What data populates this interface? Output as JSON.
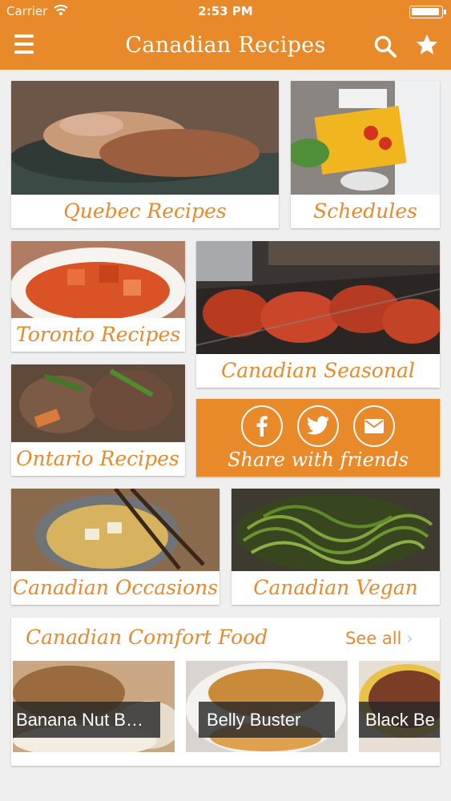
{
  "status_bar": {
    "carrier": "Carrier",
    "time": "2:53 PM"
  },
  "nav": {
    "title": "Canadian Recipes",
    "menu_icon": "hamburger-icon",
    "search_icon": "search-icon",
    "favorite_icon": "star-icon"
  },
  "tiles": {
    "quebec": "Quebec Recipes",
    "schedules": "Schedules",
    "toronto": "Toronto Recipes",
    "seasonal": "Canadian Seasonal",
    "ontario": "Ontario Recipes",
    "occasions": "Canadian Occasions",
    "vegan": "Canadian Vegan"
  },
  "share": {
    "label": "Share with friends",
    "icons": [
      "facebook-icon",
      "twitter-icon",
      "mail-icon"
    ]
  },
  "comfort": {
    "title": "Canadian Comfort Food",
    "see_all": "See all",
    "items": [
      {
        "title": "Banana Nut B…"
      },
      {
        "title": "Belly Buster"
      },
      {
        "title": "Black Be"
      }
    ]
  },
  "colors": {
    "accent": "#e8892a",
    "background": "#efefef"
  }
}
